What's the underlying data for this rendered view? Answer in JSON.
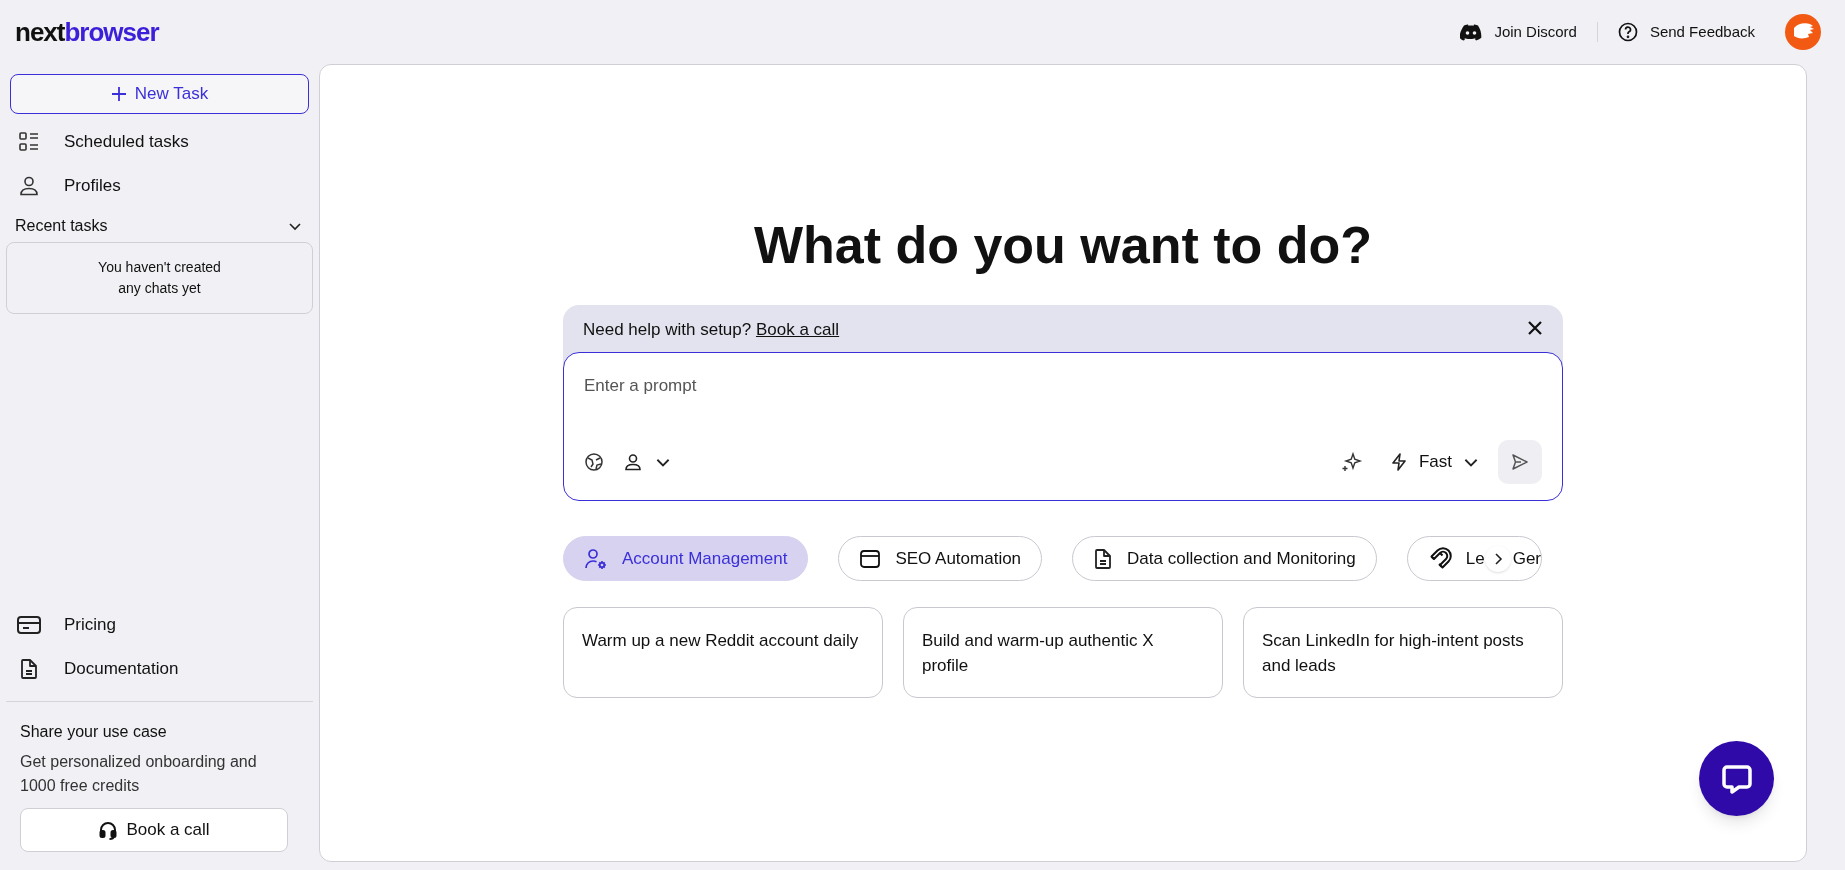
{
  "logo": {
    "dark": "next",
    "accent": "browser"
  },
  "header_links": [
    {
      "kind": "discord",
      "label": "Join Discord"
    },
    {
      "kind": "help",
      "label": "Send Feedback"
    }
  ],
  "sidebar": {
    "new_task_button": "New Task",
    "nav": [
      {
        "kind": "scheduled",
        "label": "Scheduled tasks"
      },
      {
        "kind": "profile",
        "label": "Profiles"
      }
    ],
    "recent_tasks": {
      "title": "Recent tasks",
      "expanded": true,
      "empty_text": "You haven't created\nany chats yet"
    },
    "bottom_nav": [
      {
        "kind": "card",
        "label": "Pricing"
      },
      {
        "kind": "doc",
        "label": "Documentation"
      }
    ],
    "promo": {
      "title": "Share your use case",
      "text": "Get personalized onboarding and 1000 free credits",
      "button": "Book a call"
    }
  },
  "main": {
    "heading": "What do you want to do?",
    "banner": {
      "text": "Need help with setup?",
      "link": "Book a call"
    },
    "prompt": {
      "placeholder": "Enter a prompt",
      "mode": "Fast"
    },
    "chips": [
      {
        "kind": "user-gear",
        "label": "Account Management",
        "selected": true
      },
      {
        "kind": "window",
        "label": "SEO Automation",
        "selected": false
      },
      {
        "kind": "doc",
        "label": "Data collection and Monitoring",
        "selected": false
      },
      {
        "kind": "magnet",
        "label_start": "Le",
        "label_end": "Ger",
        "selected": false
      }
    ],
    "cards": [
      "Warm up a new Reddit account daily",
      "Build and warm-up authentic X profile",
      "Scan LinkedIn for high-intent posts and leads"
    ]
  }
}
